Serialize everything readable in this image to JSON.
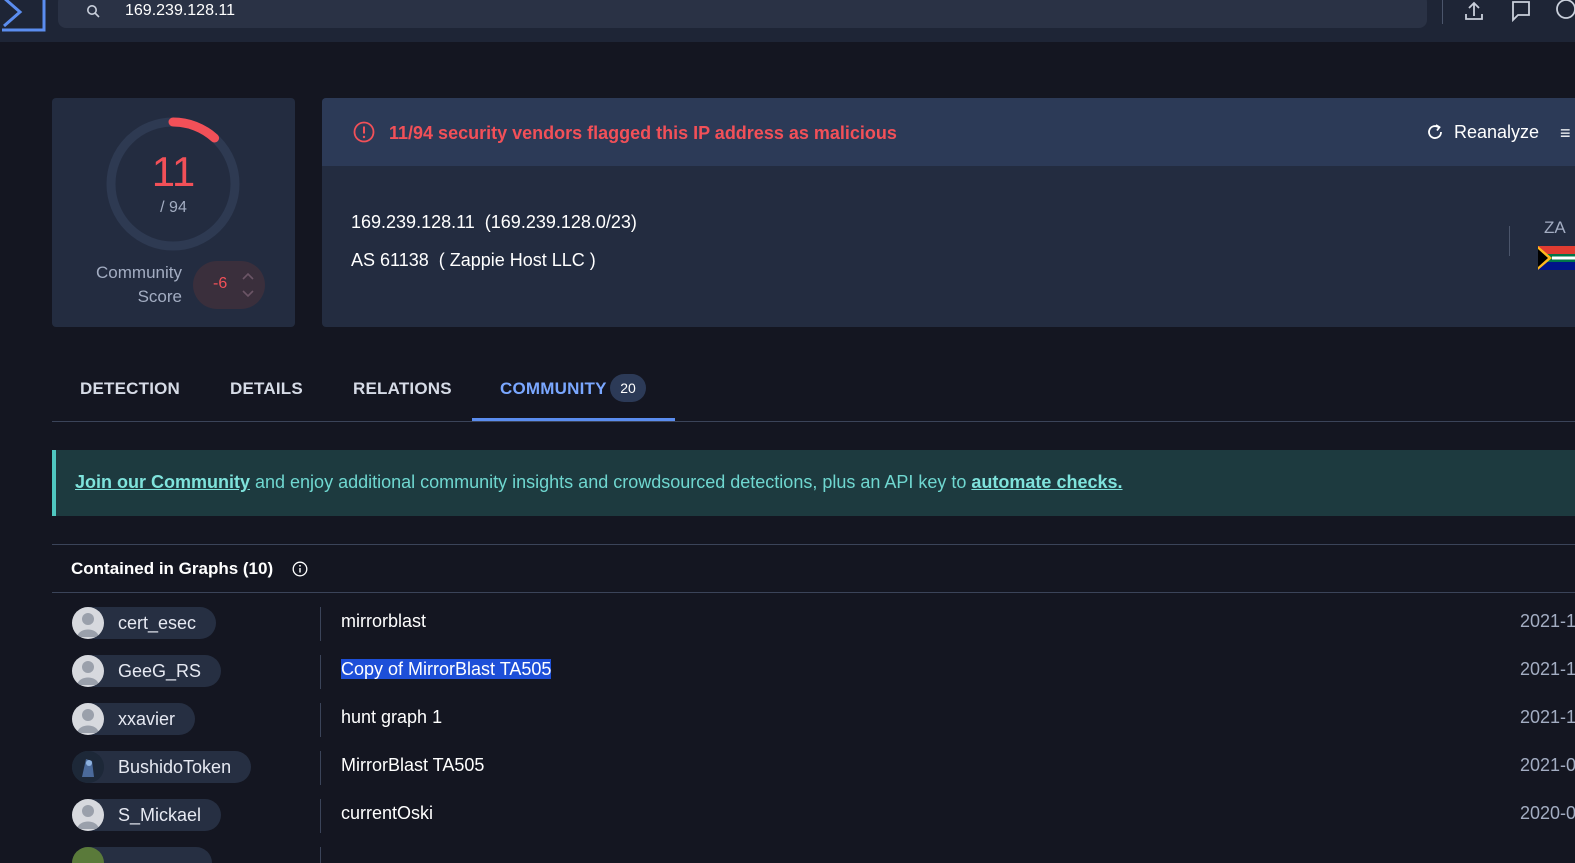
{
  "search": {
    "query": "169.239.128.11"
  },
  "score": {
    "detections": "11",
    "total": "/ 94",
    "community_label": "Community Score",
    "community_value": "-6"
  },
  "alert": {
    "text": "11/94 security vendors flagged this IP address as malicious",
    "reanalyze": "Reanalyze"
  },
  "ip": {
    "line1": "169.239.128.11  (169.239.128.0/23)",
    "line2": "AS 61138  ( Zappie Host LLC )",
    "country": "ZA"
  },
  "tabs": [
    {
      "label": "DETECTION"
    },
    {
      "label": "DETAILS"
    },
    {
      "label": "RELATIONS"
    },
    {
      "label": "COMMUNITY",
      "badge": "20"
    }
  ],
  "banner": {
    "link1": "Join our Community",
    "middle": " and enjoy additional community insights and crowdsourced detections, plus an API key to ",
    "link2": "automate checks."
  },
  "graphs": {
    "title": "Contained in Graphs  (10)",
    "rows": [
      {
        "user": "cert_esec",
        "graph": "mirrorblast",
        "date": "2021-1"
      },
      {
        "user": "GeeG_RS",
        "graph": "Copy of MirrorBlast TA505",
        "date": "2021-1"
      },
      {
        "user": "xxavier",
        "graph": "hunt graph 1",
        "date": "2021-1"
      },
      {
        "user": "BushidoToken",
        "graph": "MirrorBlast TA505",
        "date": "2021-0"
      },
      {
        "user": "S_Mickael",
        "graph": "currentOski",
        "date": "2020-0"
      }
    ]
  },
  "colors": {
    "malicious": "#f25058",
    "accent": "#5b8def",
    "banner": "#1d3a3f"
  }
}
